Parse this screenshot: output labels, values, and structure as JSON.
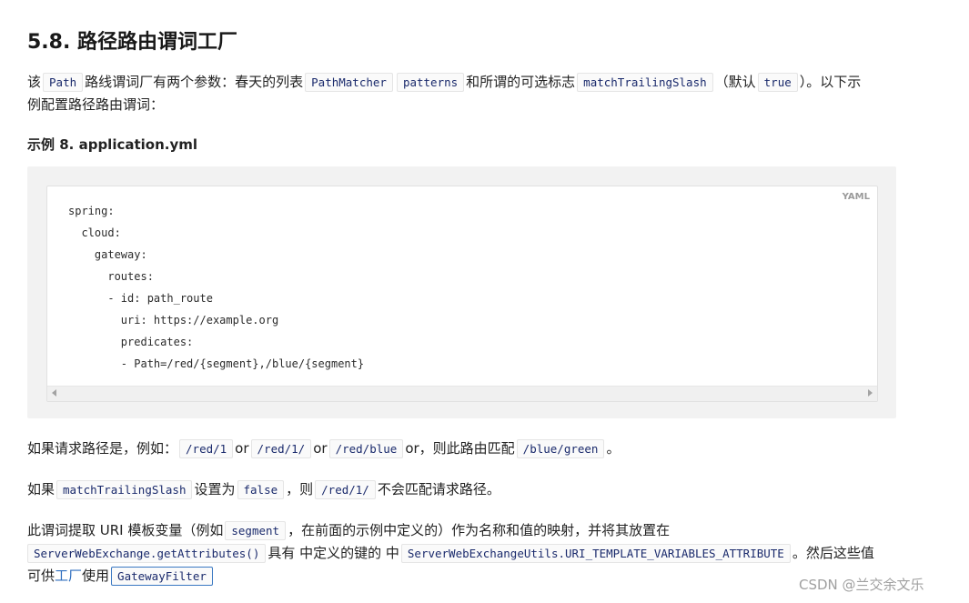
{
  "section": {
    "title": "5.8. 路径路由谓词工厂"
  },
  "intro": {
    "t1": "该",
    "c_path": "Path",
    "t2": "路线谓词厂有两个参数：春天的列表",
    "c_pathmatcher": "PathMatcher",
    "c_patterns": "patterns",
    "t3": "和所谓的可选标志",
    "c_mts": "matchTrailingSlash",
    "t4": "（默认",
    "c_true": "true",
    "t5": "）。以下示",
    "line2": "例配置路径路由谓词："
  },
  "example": {
    "title": "示例 8. application.yml",
    "lang": "YAML",
    "code_lines": [
      "spring:",
      "  cloud:",
      "    gateway:",
      "      routes:",
      "      - id: path_route",
      "        uri: https://example.org",
      "        predicates:",
      "        - Path=/red/{segment},/blue/{segment}"
    ]
  },
  "para1": {
    "t1": "如果请求路径是，例如：",
    "c1": "/red/1",
    "or1": "or",
    "c2": "/red/1/",
    "or2": "or",
    "c3": "/red/blue",
    "t2": "or，则此路由匹配",
    "c4": "/blue/green",
    "t3": "。"
  },
  "para2": {
    "t1": "如果",
    "c1": "matchTrailingSlash",
    "t2": "设置为",
    "c2": "false",
    "t3": "，则",
    "c3": "/red/1/",
    "t4": "不会匹配请求路径。"
  },
  "para3": {
    "t1": "此谓词提取 URI 模板变量（例如",
    "c1": "segment",
    "t2": "，在前面的示例中定义的）作为名称和值的映射，并将其放置在",
    "c2": "ServerWebExchange.getAttributes()",
    "t3": "具有 中定义的键的 中",
    "c3": "ServerWebExchangeUtils.URI_TEMPLATE_VARIABLES_ATTRIBUTE",
    "t4": "。然后这些值",
    "t5": "可供",
    "link": "工厂",
    "t6": "使用",
    "c4": "GatewayFilter"
  },
  "watermark": "CSDN @兰交余文乐"
}
